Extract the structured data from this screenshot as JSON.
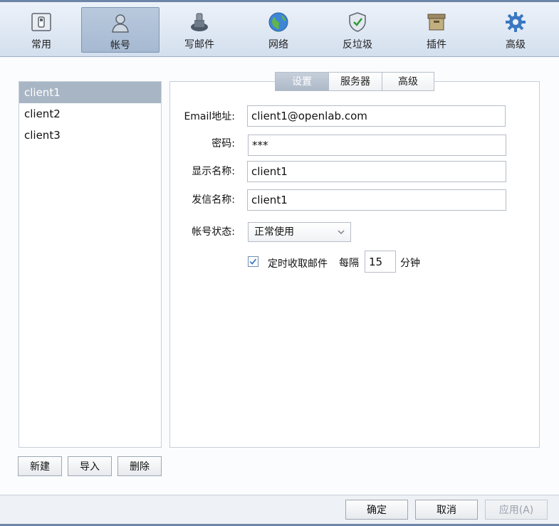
{
  "toolbar": {
    "items": [
      {
        "label": "常用",
        "icon": "general-icon",
        "active": false
      },
      {
        "label": "帐号",
        "icon": "user-icon",
        "active": true
      },
      {
        "label": "写邮件",
        "icon": "compose-icon",
        "active": false
      },
      {
        "label": "网络",
        "icon": "globe-icon",
        "active": false
      },
      {
        "label": "反垃圾",
        "icon": "shield-check-icon",
        "active": false
      },
      {
        "label": "插件",
        "icon": "box-icon",
        "active": false
      },
      {
        "label": "高级",
        "icon": "gear-icon",
        "active": false
      }
    ]
  },
  "accounts": {
    "items": [
      "client1",
      "client2",
      "client3"
    ],
    "selected_index": 0,
    "buttons": {
      "new": "新建",
      "import": "导入",
      "delete": "删除"
    }
  },
  "tabs": {
    "items": [
      "设置",
      "服务器",
      "高级"
    ],
    "active_index": 0
  },
  "form": {
    "email_label": "Email地址:",
    "email_value": "client1@openlab.com",
    "password_label": "密码:",
    "password_value": "***",
    "display_name_label": "显示名称:",
    "display_name_value": "client1",
    "sender_name_label": "发信名称:",
    "sender_name_value": "client1",
    "status_label": "帐号状态:",
    "status_value": "正常使用",
    "auto_fetch_label": "定时收取邮件",
    "auto_fetch_checked": true,
    "interval_prefix": "每隔",
    "interval_value": "15",
    "interval_unit": "分钟"
  },
  "footer": {
    "ok": "确定",
    "cancel": "取消",
    "apply": "应用(A)"
  },
  "colors": {
    "accent": "#6d86a8",
    "selected_row": "#a8b5c4",
    "checkbox_check": "#3a78c2"
  }
}
